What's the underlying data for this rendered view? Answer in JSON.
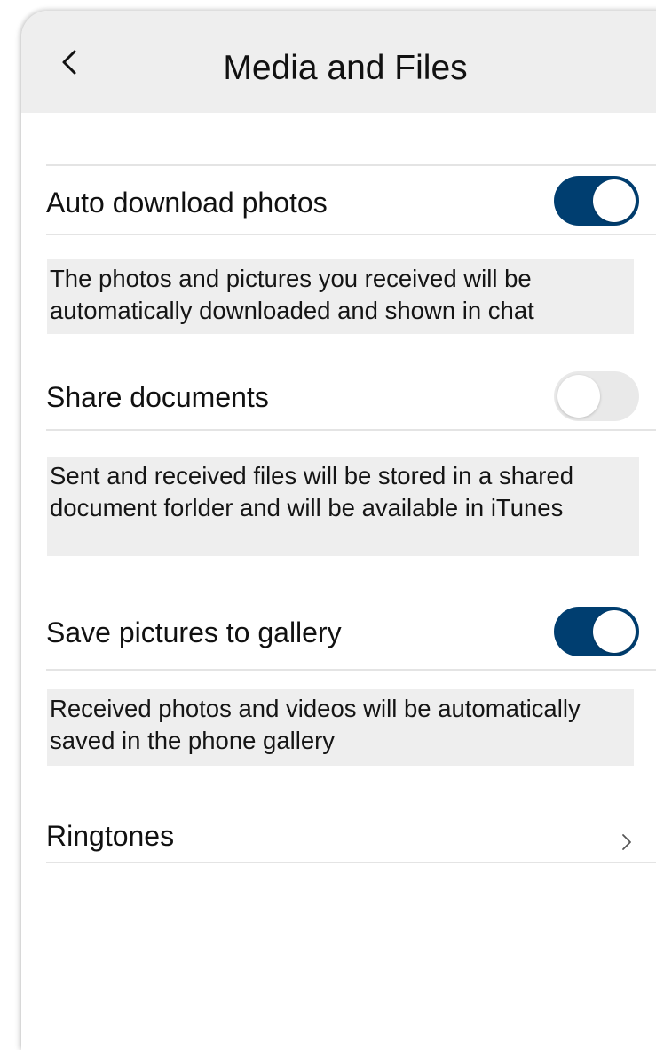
{
  "header": {
    "title": "Media and Files",
    "back_icon": "chevron-left-icon"
  },
  "settings": {
    "auto_download": {
      "label": "Auto download photos",
      "enabled": true,
      "description": "The photos and pictures you received will be automatically downloaded and shown in chat"
    },
    "share_documents": {
      "label": "Share documents",
      "enabled": false,
      "description": "Sent and received files will be stored in a shared document forlder and will be available in iTunes"
    },
    "save_gallery": {
      "label": "Save pictures to gallery",
      "enabled": true,
      "description": "Received photos and videos will be automatically saved in the phone gallery"
    },
    "ringtones": {
      "label": "Ringtones",
      "icon": "chevron-right-icon"
    }
  },
  "colors": {
    "toggle_on": "#003e70",
    "toggle_off": "#e9e9e9",
    "header_bg": "#eeeeee",
    "description_bg": "#eeeeee"
  }
}
